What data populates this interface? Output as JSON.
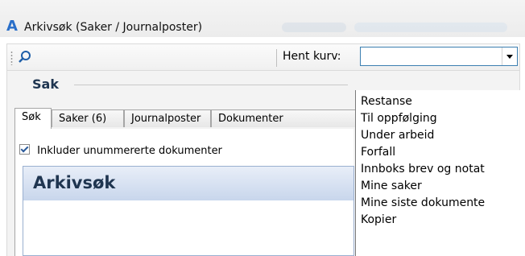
{
  "window": {
    "title": "Arkivsøk (Saker / Journalposter)",
    "app_icon": "A"
  },
  "toolbar": {
    "search_icon": "search-icon",
    "kurv_label": "Hent kurv:",
    "kurv_value": ""
  },
  "tabs": [
    {
      "label": "Søk",
      "active": true
    },
    {
      "label": "Saker (6)",
      "active": false
    },
    {
      "label": "Journalposter",
      "active": false
    },
    {
      "label": "Dokumenter",
      "active": false
    }
  ],
  "filter": {
    "include_unnumbered_label": "Inkluder unummererte dokumenter",
    "include_unnumbered_checked": true
  },
  "search_panel": {
    "title": "Arkivsøk",
    "section_label": "Sak"
  },
  "dropdown": {
    "items": [
      "Restanse",
      "Til oppfølging",
      "Under arbeid",
      "Forfall",
      "Innboks brev og notat",
      "Mine saker",
      "Mine siste dokumente",
      "Kopier"
    ]
  },
  "colors": {
    "accent": "#3c7fb1",
    "panel_header": "#c8d6ec",
    "title_text": "#1f3550"
  }
}
